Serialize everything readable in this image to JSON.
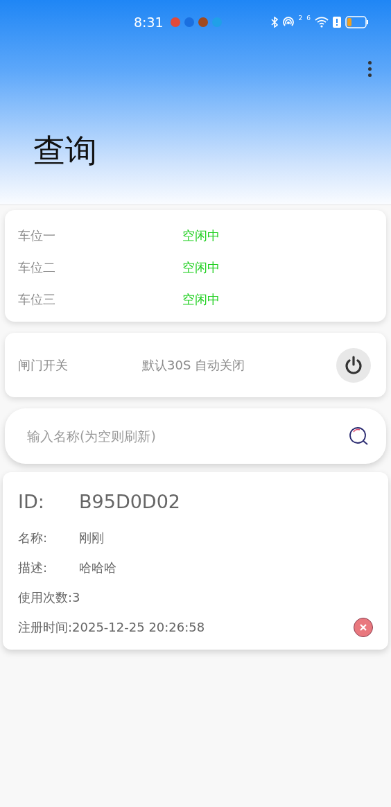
{
  "status_bar": {
    "time": "8:31",
    "sim_labels": [
      "2",
      "6"
    ]
  },
  "header": {
    "title": "查询"
  },
  "parking": [
    {
      "name": "车位一",
      "status": "空闲中",
      "free": true
    },
    {
      "name": "车位二",
      "status": "空闲中",
      "free": true
    },
    {
      "name": "车位三",
      "status": "空闲中",
      "free": true
    }
  ],
  "gate": {
    "label": "闸门开关",
    "hint": "默认30S 自动关闭"
  },
  "search": {
    "placeholder": "输入名称(为空则刷新)"
  },
  "result": {
    "id_label": "ID:",
    "id": "B95D0D02",
    "fields": [
      {
        "label": "名称:",
        "value": "刚刚"
      },
      {
        "label": "描述:",
        "value": "哈哈哈"
      }
    ],
    "uses": "使用次数:3",
    "registered": "注册时间:2025-12-25 20:26:58"
  }
}
